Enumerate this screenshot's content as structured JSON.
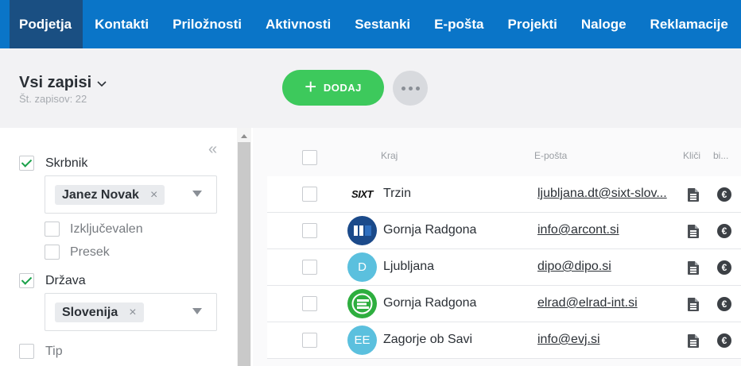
{
  "nav": {
    "items": [
      {
        "label": "Podjetja",
        "active": true
      },
      {
        "label": "Kontakti"
      },
      {
        "label": "Priložnosti"
      },
      {
        "label": "Aktivnosti"
      },
      {
        "label": "Sestanki"
      },
      {
        "label": "E-pošta"
      },
      {
        "label": "Projekti"
      },
      {
        "label": "Naloge"
      },
      {
        "label": "Reklamacije"
      }
    ],
    "color": "#0a75c8",
    "active_color": "#1a4f82"
  },
  "header": {
    "view_title": "Vsi zapisi",
    "record_count": "Št. zapisov: 22",
    "add_label": "DODAJ",
    "add_color": "#3dc95c"
  },
  "filters": {
    "collapse_icon": "double-chevron-left-icon",
    "owner": {
      "label": "Skrbnik",
      "checked": true,
      "tag": "Janez Novak",
      "tag_remove": "×"
    },
    "exclusive": {
      "label": "Izključevalen",
      "checked": false
    },
    "intersection": {
      "label": "Presek",
      "checked": false
    },
    "country": {
      "label": "Država",
      "checked": true,
      "tag": "Slovenija",
      "tag_remove": "×"
    },
    "type": {
      "label": "Tip",
      "checked": false
    }
  },
  "table": {
    "columns": {
      "city": "Kraj",
      "email": "E-pošta",
      "call": "Kliči",
      "bi": "bi..."
    },
    "rows": [
      {
        "logo": "sixt-logo",
        "logo_text": "SIXT",
        "city": "Trzin",
        "email": "ljubljana.dt@sixt-slov..."
      },
      {
        "logo": "arcont-logo",
        "logo_text": "A",
        "city": "Gornja Radgona",
        "email": "info@arcont.si"
      },
      {
        "logo": "initials-avatar",
        "logo_text": "D",
        "city": "Ljubljana",
        "email": "dipo@dipo.si"
      },
      {
        "logo": "elrad-logo",
        "logo_text": "",
        "city": "Gornja Radgona",
        "email": "elrad@elrad-int.si"
      },
      {
        "logo": "initials-avatar",
        "logo_text": "EE",
        "city": "Zagorje ob Savi",
        "email": "info@evj.si"
      }
    ]
  }
}
